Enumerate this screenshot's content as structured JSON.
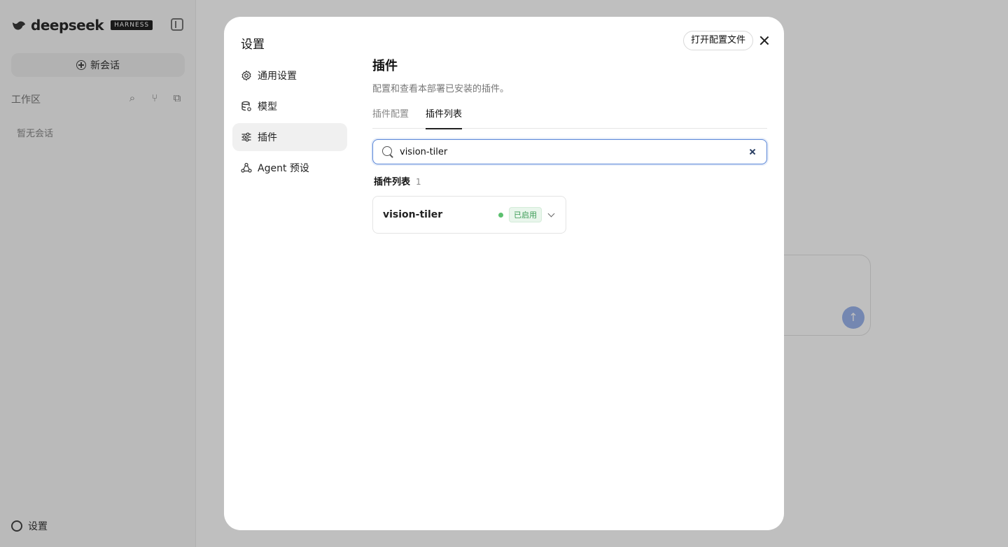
{
  "app": {
    "brand_name": "deepseek",
    "brand_badge": "HARNESS",
    "new_chat_label": "新会话",
    "workspace_label": "工作区",
    "empty_sessions": "暂无会话",
    "settings_label": "设置"
  },
  "modal": {
    "title": "设置",
    "open_config_label": "打开配置文件",
    "nav": [
      {
        "label": "通用设置",
        "icon": "gear-icon"
      },
      {
        "label": "模型",
        "icon": "database-icon"
      },
      {
        "label": "插件",
        "icon": "sliders-icon"
      },
      {
        "label": "Agent 预设",
        "icon": "agent-icon"
      }
    ],
    "active_nav": "插件",
    "section": {
      "title": "插件",
      "description": "配置和查看本部署已安装的插件。",
      "tabs": [
        "插件配置",
        "插件列表"
      ],
      "active_tab": "插件列表",
      "search_value": "vision-tiler",
      "list_heading": "插件列表",
      "list_count": "1",
      "plugins": [
        {
          "name": "vision-tiler",
          "status": "已启用",
          "status_color": "#5cc06f"
        }
      ]
    }
  }
}
